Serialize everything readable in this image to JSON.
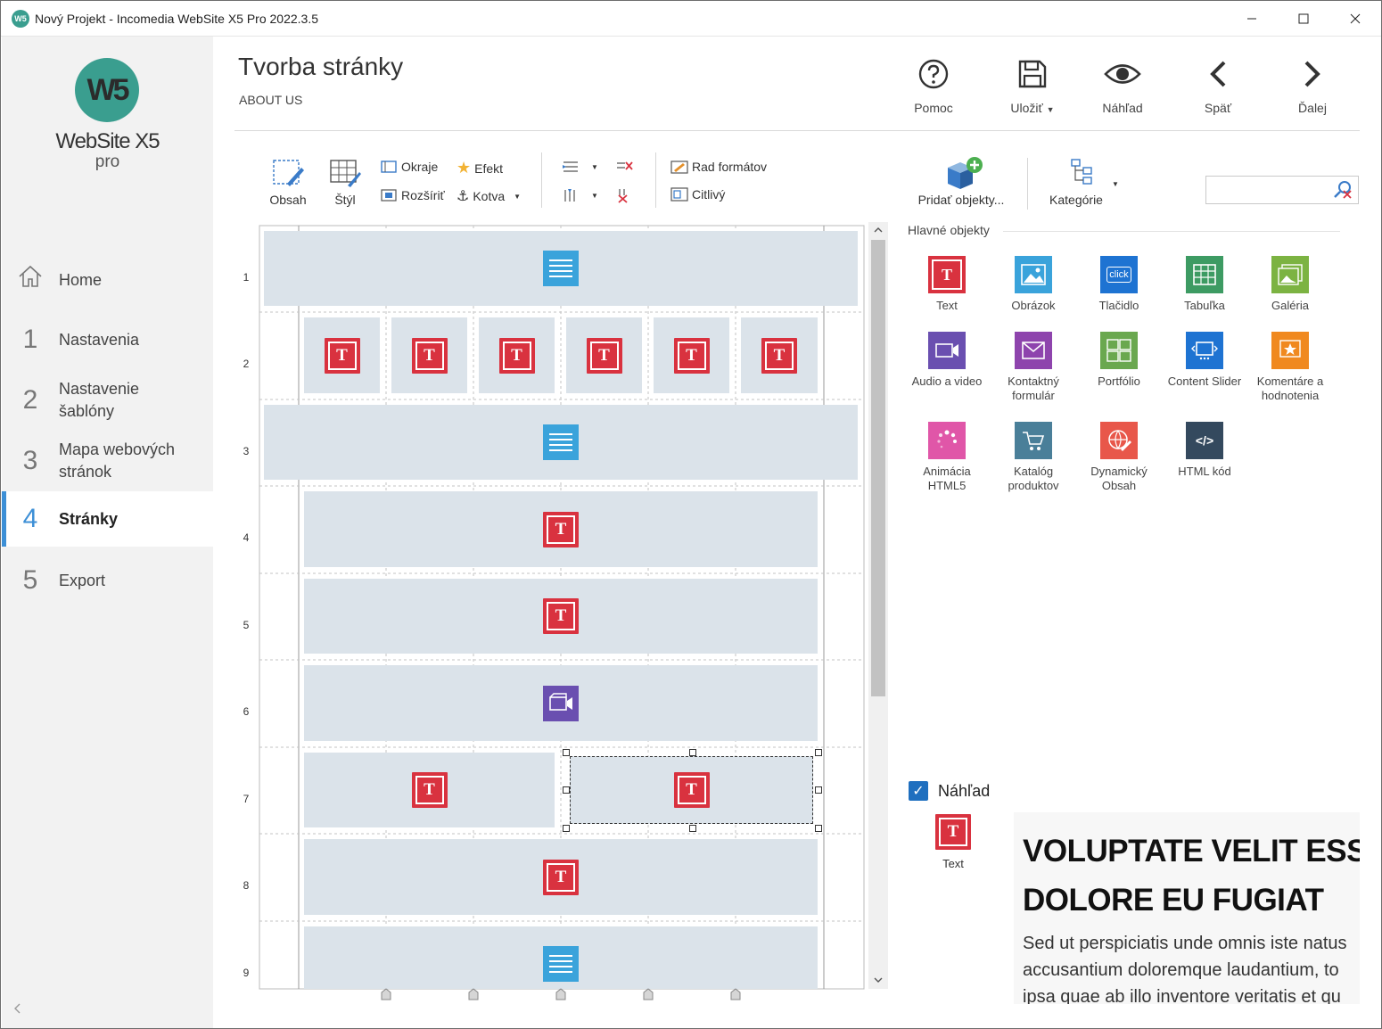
{
  "window": {
    "title": "Nový Projekt - Incomedia WebSite X5 Pro 2022.3.5",
    "app_icon": "W5"
  },
  "sidebar": {
    "logo_mark": "W5",
    "logo_name": "WebSite X5",
    "logo_sub": "pro",
    "items": [
      {
        "num": "",
        "label": "Home"
      },
      {
        "num": "1",
        "label": "Nastavenia"
      },
      {
        "num": "2",
        "label": "Nastavenie šablóny"
      },
      {
        "num": "3",
        "label": "Mapa webových stránok"
      },
      {
        "num": "4",
        "label": "Stránky"
      },
      {
        "num": "5",
        "label": "Export"
      }
    ]
  },
  "header": {
    "title": "Tvorba stránky",
    "subtitle": "ABOUT US",
    "actions": [
      {
        "label": "Pomoc",
        "icon": "help-icon"
      },
      {
        "label": "Uložiť",
        "icon": "save-icon"
      },
      {
        "label": "Náhľad",
        "icon": "eye-icon"
      },
      {
        "label": "Späť",
        "icon": "back-icon"
      },
      {
        "label": "Ďalej",
        "icon": "forward-icon"
      }
    ]
  },
  "toolbar": {
    "content": "Obsah",
    "style": "Štýl",
    "borders": "Okraje",
    "effect": "Efekt",
    "expand": "Rozšíriť",
    "anchor": "Kotva",
    "format_order": "Rad formátov",
    "responsive": "Citlivý",
    "add_objects": "Pridať objekty...",
    "categories": "Kategórie"
  },
  "search": {
    "placeholder": ""
  },
  "grid": {
    "row_numbers": [
      "1",
      "2",
      "3",
      "4",
      "5",
      "6",
      "7",
      "8",
      "9"
    ]
  },
  "objects_panel": {
    "heading": "Hlavné objekty",
    "items": [
      {
        "label": "Text",
        "icon": "text-object-icon",
        "color": "#d9323f"
      },
      {
        "label": "Obrázok",
        "icon": "image-object-icon",
        "color": "#3aa3db"
      },
      {
        "label": "Tlačidlo",
        "icon": "button-object-icon",
        "color": "#1e73d2"
      },
      {
        "label": "Tabuľka",
        "icon": "table-object-icon",
        "color": "#3d9b63"
      },
      {
        "label": "Galéria",
        "icon": "gallery-object-icon",
        "color": "#7cb342"
      },
      {
        "label": "Audio a video",
        "icon": "audio-video-object-icon",
        "color": "#6a4fb0"
      },
      {
        "label": "Kontaktný formulár",
        "icon": "contact-form-object-icon",
        "color": "#8e44ad"
      },
      {
        "label": "Portfólio",
        "icon": "portfolio-object-icon",
        "color": "#6aa84f"
      },
      {
        "label": "Content Slider",
        "icon": "content-slider-object-icon",
        "color": "#1e73d2"
      },
      {
        "label": "Komentáre a hodnotenia",
        "icon": "comments-object-icon",
        "color": "#f0891f"
      },
      {
        "label": "Animácia HTML5",
        "icon": "animation-object-icon",
        "color": "#e056a8"
      },
      {
        "label": "Katalóg produktov",
        "icon": "catalog-object-icon",
        "color": "#4a7f99"
      },
      {
        "label": "Dynamický Obsah",
        "icon": "dynamic-content-object-icon",
        "color": "#e8574a"
      },
      {
        "label": "HTML kód",
        "icon": "html-code-object-icon",
        "color": "#34495e"
      }
    ],
    "button_icon_text": "click",
    "html_icon_text": "</>"
  },
  "preview": {
    "checkbox_label": "Náhľad",
    "object_label": "Text",
    "heading_line1": "VOLUPTATE VELIT ESSE",
    "heading_line2": "DOLORE EU FUGIAT",
    "para_line1": "Sed ut perspiciatis unde omnis iste natus",
    "para_line2": "accusantium doloremque laudantium, to",
    "para_line3": "ipsa quae ab illo inventore veritatis et qu"
  }
}
